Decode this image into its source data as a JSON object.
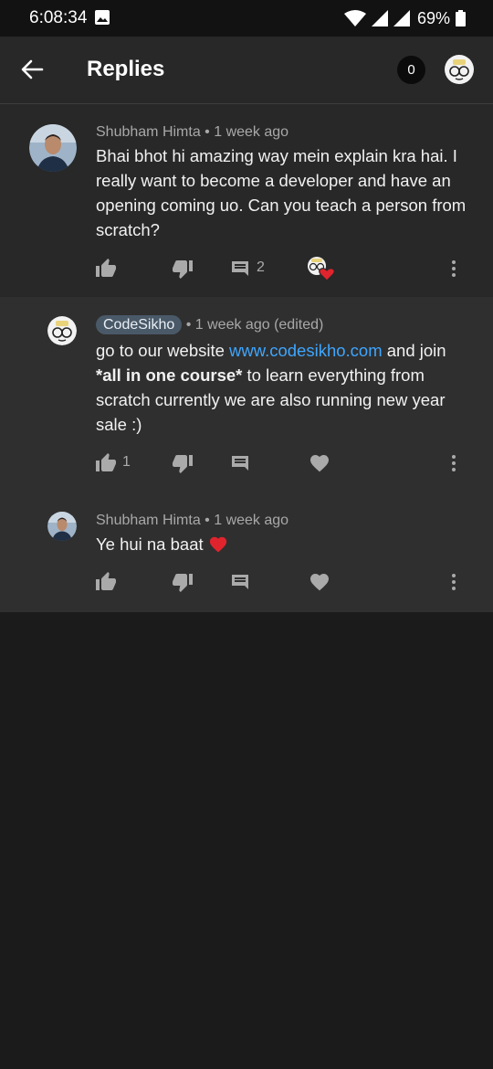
{
  "status_bar": {
    "time": "6:08:34",
    "battery": "69%"
  },
  "header": {
    "title": "Replies",
    "notification_count": "0"
  },
  "comment": {
    "author": "Shubham Himta",
    "time": "• 1 week ago",
    "text": "Bhai bhot hi amazing way mein explain kra hai. I really want to become a developer and have an opening coming uo. Can you teach a person from scratch?",
    "reply_count": "2"
  },
  "replies": [
    {
      "author": "CodeSikho",
      "time": "• 1 week ago (edited)",
      "text_1": "go to our website ",
      "link": "www.codesikho.com",
      "text_2": " and join ",
      "bold": "*all in one course*",
      "text_3": " to learn everything from scratch currently we are also running new year sale :)",
      "like_count": "1"
    },
    {
      "author": "Shubham Himta",
      "time": "• 1 week ago",
      "text": "Ye hui na baat"
    }
  ],
  "colors": {
    "accent_link": "#3ea6ff",
    "heart": "#e0242d",
    "chip": "#4a5968"
  }
}
